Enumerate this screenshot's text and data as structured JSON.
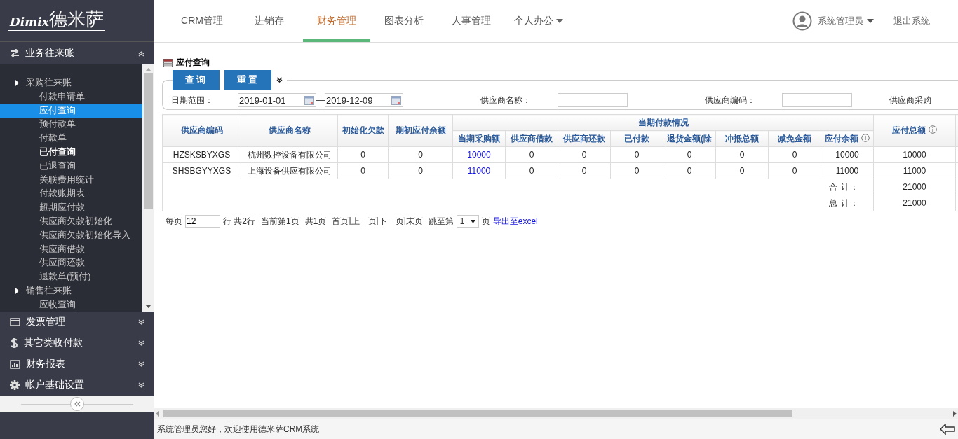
{
  "logo": {
    "latin": "Dimix",
    "chinese": "德米萨"
  },
  "nav_tabs": [
    {
      "label": "CRM管理",
      "selected": false,
      "dropdown": false
    },
    {
      "label": "进销存",
      "selected": false,
      "dropdown": false
    },
    {
      "label": "财务管理",
      "selected": true,
      "dropdown": false
    },
    {
      "label": "图表分析",
      "selected": false,
      "dropdown": false
    },
    {
      "label": "人事管理",
      "selected": false,
      "dropdown": false
    },
    {
      "label": "个人办公",
      "selected": false,
      "dropdown": true
    }
  ],
  "user": {
    "name": "系统管理员",
    "logout": "退出系统"
  },
  "sidebar": {
    "sections": [
      {
        "label": "业务往来账",
        "expanded": true,
        "groups": [
          {
            "label": "采购往来账",
            "children": [
              {
                "label": "付款申请单",
                "selected": false,
                "hover": false
              },
              {
                "label": "应付查询",
                "selected": true,
                "hover": false
              },
              {
                "label": "预付款单",
                "selected": false,
                "hover": false
              },
              {
                "label": "付款单",
                "selected": false,
                "hover": false
              },
              {
                "label": "已付查询",
                "selected": false,
                "hover": true
              },
              {
                "label": "已退查询",
                "selected": false,
                "hover": false
              },
              {
                "label": "关联费用统计",
                "selected": false,
                "hover": false
              },
              {
                "label": "付款账期表",
                "selected": false,
                "hover": false
              },
              {
                "label": "超期应付款",
                "selected": false,
                "hover": false
              },
              {
                "label": "供应商欠款初始化",
                "selected": false,
                "hover": false
              },
              {
                "label": "供应商欠款初始化导入",
                "selected": false,
                "hover": false
              },
              {
                "label": "供应商借款",
                "selected": false,
                "hover": false
              },
              {
                "label": "供应商还款",
                "selected": false,
                "hover": false
              },
              {
                "label": "退款单(预付)",
                "selected": false,
                "hover": false
              }
            ]
          },
          {
            "label": "销售往来账",
            "children": [
              {
                "label": "应收查询",
                "selected": false,
                "hover": false
              }
            ]
          }
        ]
      },
      {
        "label": "发票管理",
        "expanded": false
      },
      {
        "label": "其它类收付款",
        "expanded": false
      },
      {
        "label": "财务报表",
        "expanded": false
      },
      {
        "label": "帐户基础设置",
        "expanded": false
      }
    ]
  },
  "page": {
    "title": "应付查询",
    "buttons": [
      "查询",
      "重置"
    ],
    "filters": [
      {
        "kind": "date_range",
        "label": "日期范围：",
        "from": "2019-01-01",
        "separator": "—",
        "to": "2019-12-09"
      },
      {
        "kind": "text",
        "label": "供应商名称："
      },
      {
        "kind": "text",
        "label": "供应商编码："
      },
      {
        "kind": "label_only",
        "label": "供应商采购"
      }
    ]
  },
  "table": {
    "columns": [
      {
        "label": "供应商编码"
      },
      {
        "label": "供应商名称"
      },
      {
        "label": "初始化欠款"
      },
      {
        "label": "期初应付余额"
      }
    ],
    "group": {
      "label": "当期付款情况",
      "columns": [
        {
          "label": "当期采购额",
          "link": true,
          "info": false
        },
        {
          "label": "供应商借款",
          "link": false,
          "info": false
        },
        {
          "label": "供应商还款",
          "link": false,
          "info": false
        },
        {
          "label": "已付款",
          "link": false,
          "info": false
        },
        {
          "label": "退货金额(除",
          "link": false,
          "info": false
        },
        {
          "label": "冲抵总额",
          "link": false,
          "info": false
        },
        {
          "label": "减免金额",
          "link": false,
          "info": false
        },
        {
          "label": "应付余额",
          "link": false,
          "info": true
        }
      ]
    },
    "total_column": {
      "label": "应付总额",
      "info": true
    },
    "rows": [
      {
        "cells": [
          "HZSKSBYXGS",
          "杭州数控设备有限公司",
          "0",
          "0",
          "10000",
          "0",
          "0",
          "0",
          "0",
          "0",
          "0",
          "10000",
          "10000"
        ]
      },
      {
        "cells": [
          "SHSBGYYXGS",
          "上海设备供应有限公司",
          "0",
          "0",
          "11000",
          "0",
          "0",
          "0",
          "0",
          "0",
          "0",
          "11000",
          "11000"
        ]
      }
    ],
    "summary": [
      {
        "label": "合 计：",
        "value": "21000"
      },
      {
        "label": "总 计：",
        "value": "21000"
      }
    ]
  },
  "pagination": {
    "per_page_label": "每页",
    "per_page": "12",
    "rows_text": "行 共2行",
    "current_text": "当前第1页",
    "pages_text": "共1页",
    "links": [
      "首页",
      "上一页",
      "下一页",
      "末页"
    ],
    "link_separator": "|",
    "jump_label": "跳至第",
    "page": "1",
    "page_suffix": "页",
    "export": "导出至excel"
  },
  "status_bar": "系统管理员您好，欢迎使用德米萨CRM系统"
}
